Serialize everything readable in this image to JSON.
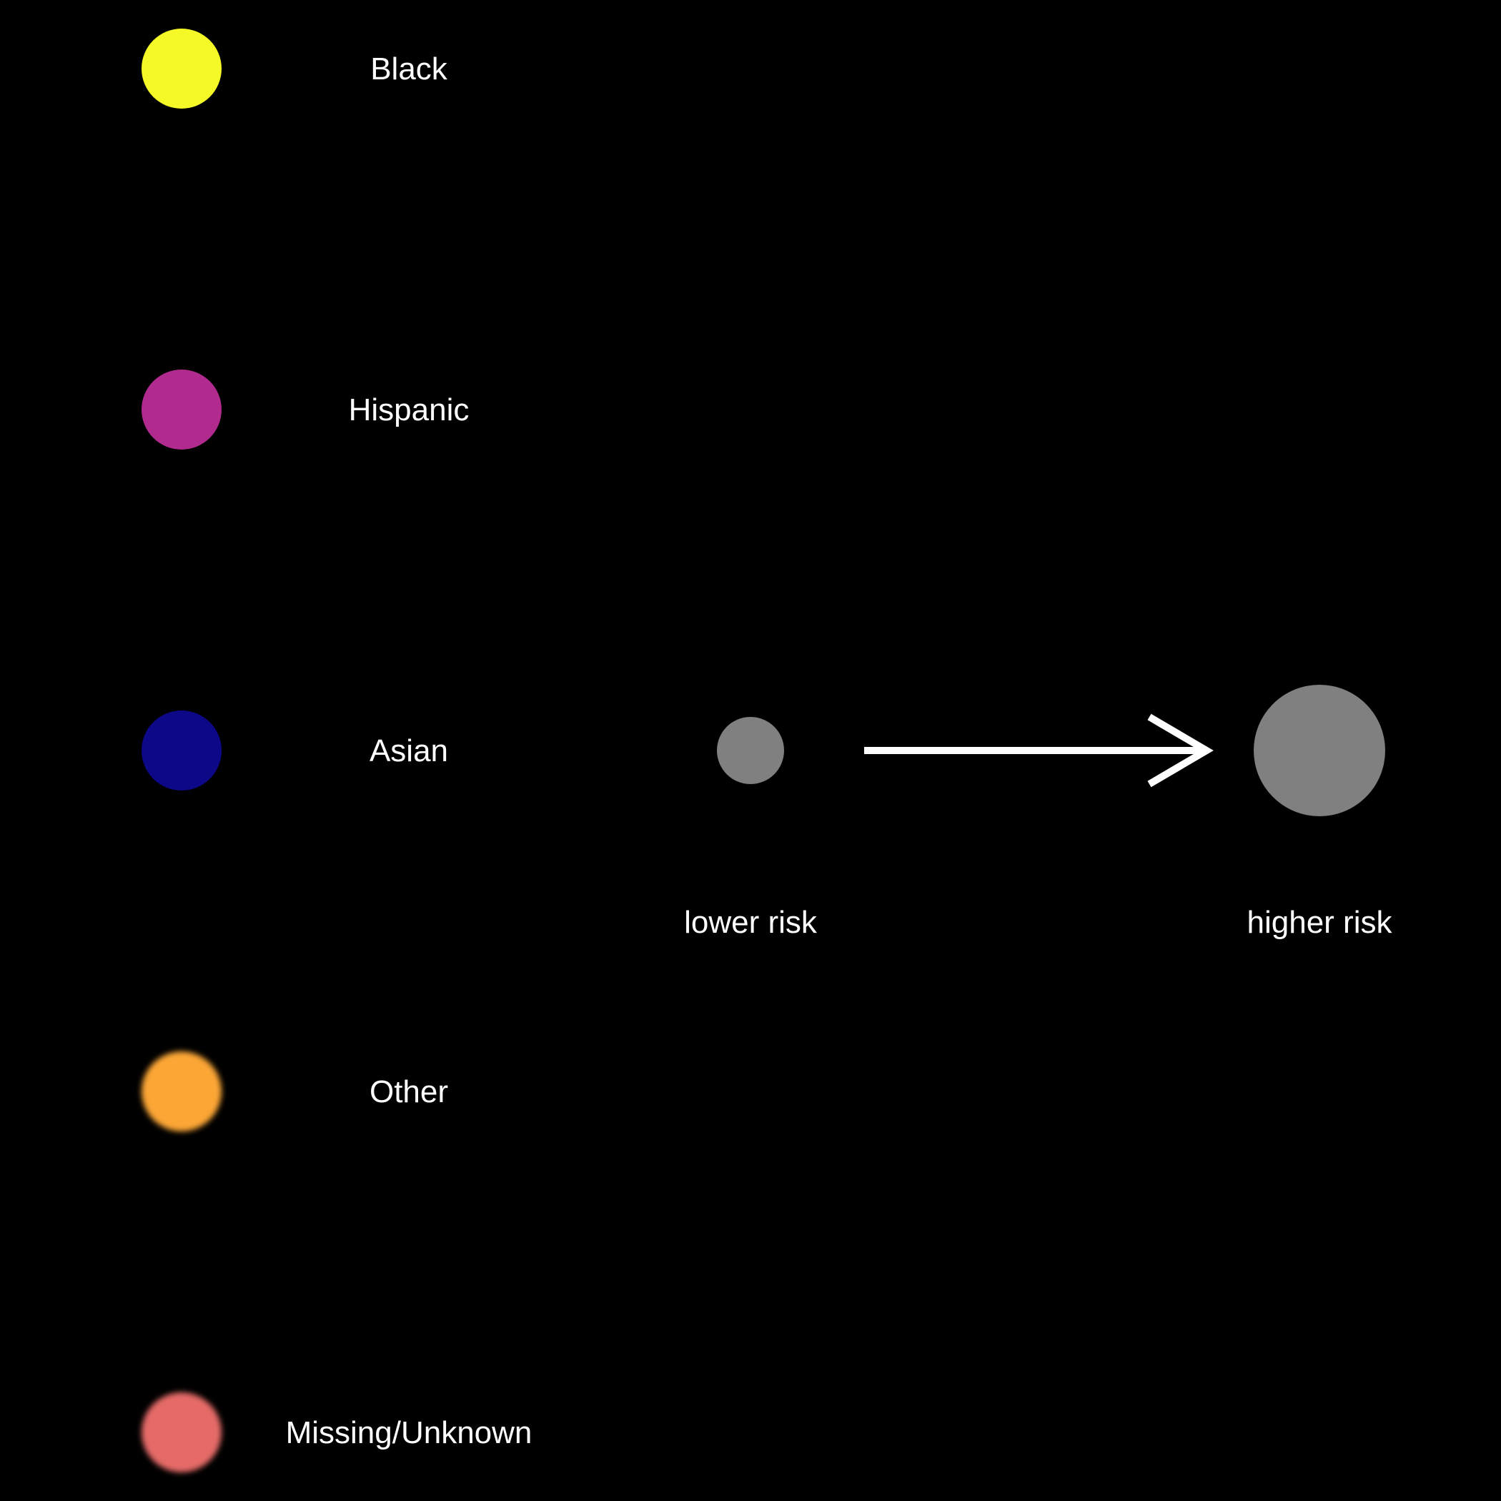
{
  "chart_data": {
    "type": "legend",
    "categories": [
      {
        "label": "Black",
        "color": "#f5f927",
        "blurred": false
      },
      {
        "label": "Hispanic",
        "color": "#b12a8e",
        "blurred": false
      },
      {
        "label": "Asian",
        "color": "#0d0887",
        "blurred": false
      },
      {
        "label": "Other",
        "color": "#fca636",
        "blurred": true
      },
      {
        "label": "Missing/Unknown",
        "color": "#e56b68",
        "blurred": true
      }
    ],
    "size_scale": {
      "low_label": "lower risk",
      "high_label": "higher risk",
      "marker_color": "#808080",
      "arrow_color": "#ffffff"
    }
  },
  "colors": {
    "background": "#000000",
    "text": "#ffffff"
  }
}
